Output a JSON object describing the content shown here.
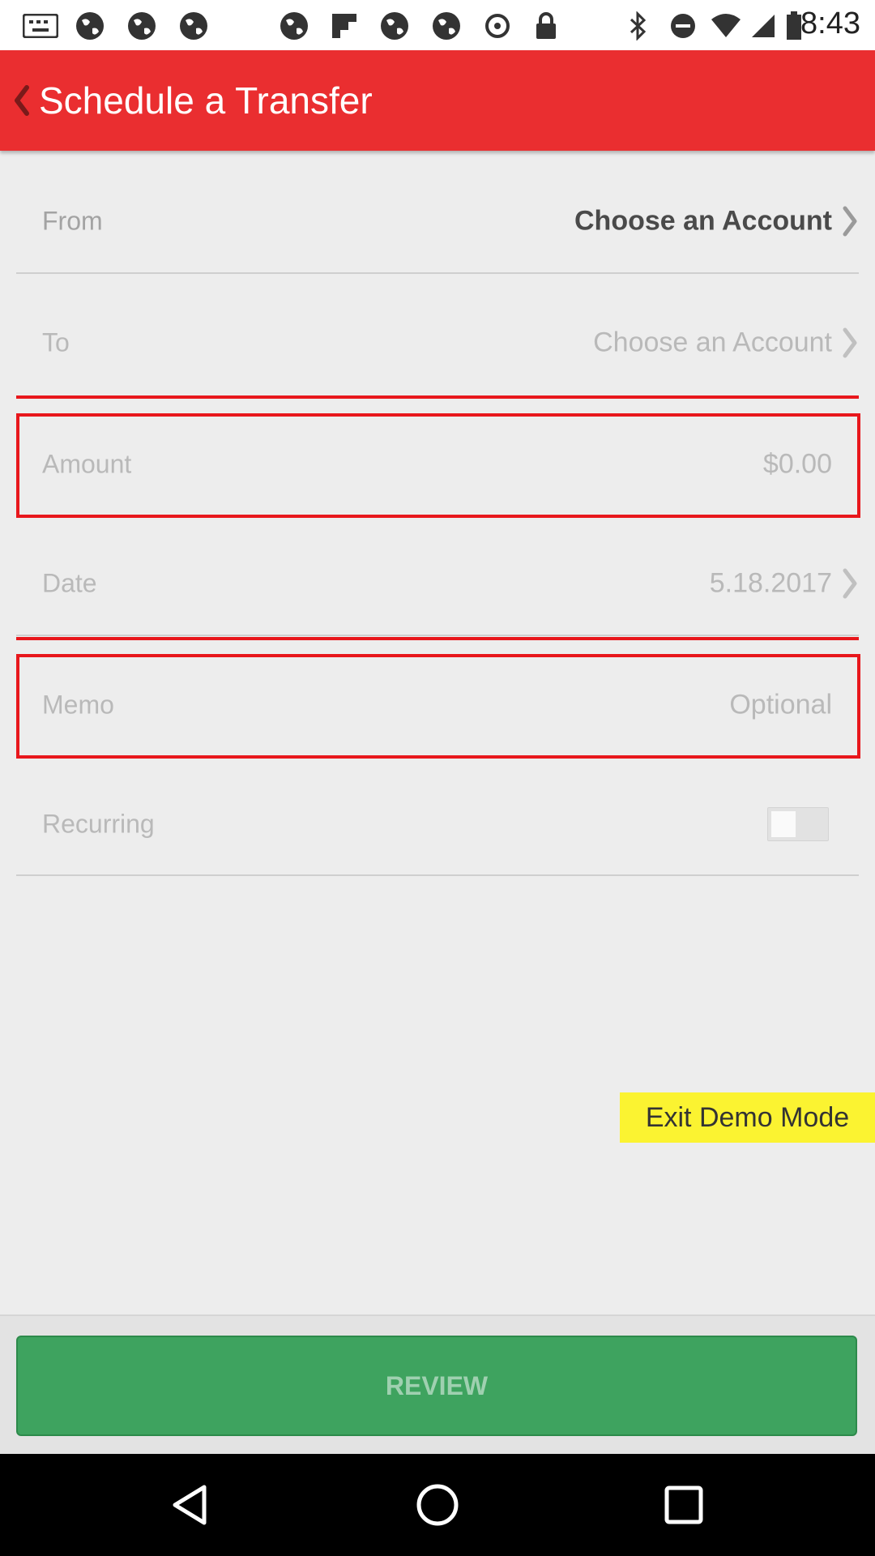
{
  "status_bar": {
    "time": "8:43",
    "icons": [
      "notification-icon",
      "globe-icon",
      "globe-icon",
      "globe-icon",
      "globe-icon",
      "flipboard-icon",
      "globe-icon",
      "globe-icon",
      "data-saver-icon",
      "lock-icon",
      "bluetooth-icon",
      "do-not-disturb-icon",
      "wifi-icon",
      "signal-icon",
      "battery-icon"
    ]
  },
  "header": {
    "title": "Schedule a Transfer",
    "back_icon": "chevron-left-icon",
    "background_color": "#ea2e30"
  },
  "form": {
    "from": {
      "label": "From",
      "value": "Choose an Account"
    },
    "to": {
      "label": "To",
      "value": "Choose an Account"
    },
    "amount": {
      "label": "Amount",
      "value": "$0.00"
    },
    "date": {
      "label": "Date",
      "value": "5.18.2017"
    },
    "memo": {
      "label": "Memo",
      "placeholder": "Optional"
    },
    "recurring": {
      "label": "Recurring",
      "enabled": false
    }
  },
  "exit_demo": {
    "label": "Exit Demo Mode",
    "color": "#fbf331"
  },
  "review_button": {
    "label": "REVIEW",
    "color": "#3ea35f"
  },
  "nav_bar": {
    "icons": [
      "back-triangle-icon",
      "home-circle-icon",
      "recents-square-icon"
    ]
  }
}
